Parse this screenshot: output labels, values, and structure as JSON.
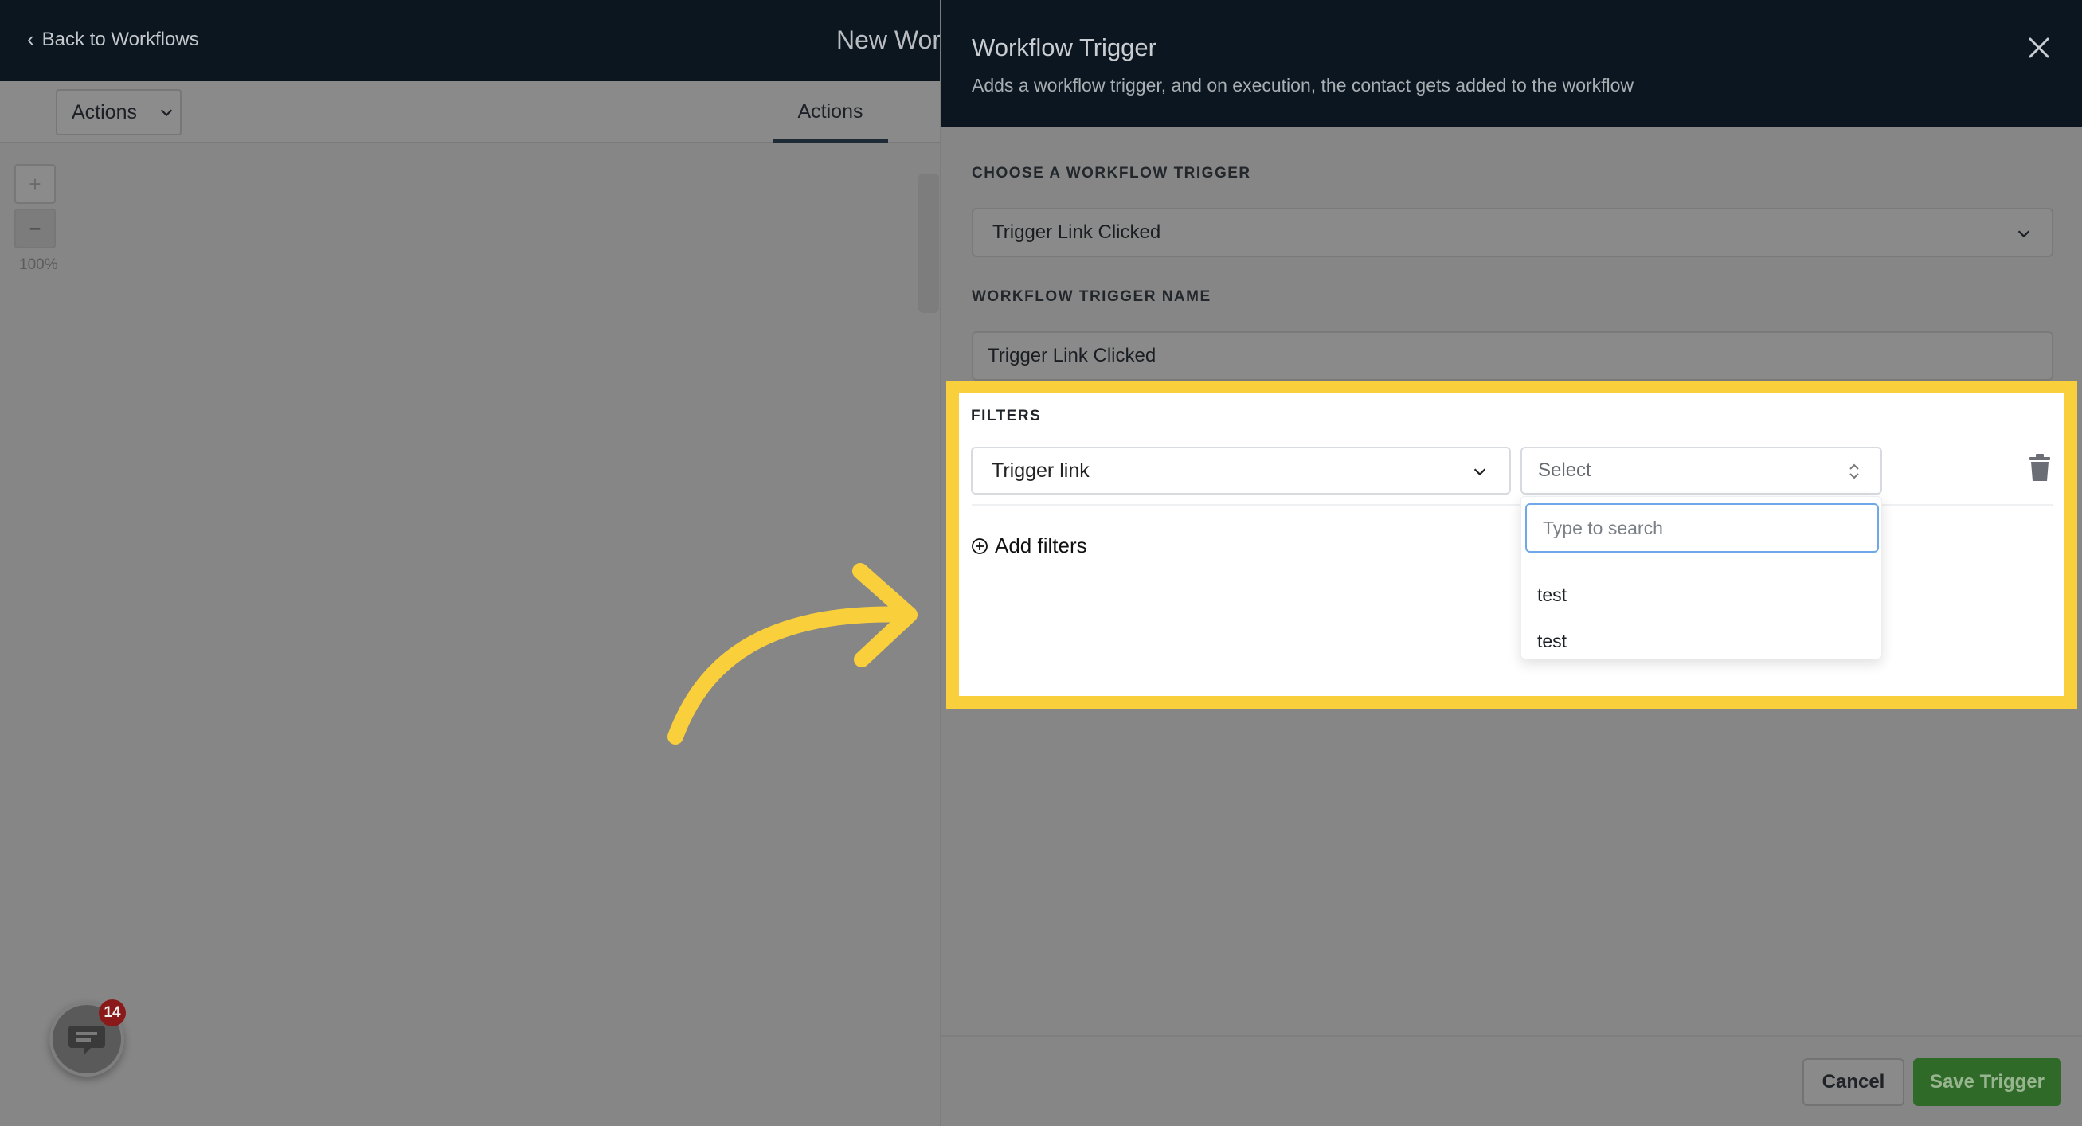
{
  "editor": {
    "back_label": "Back to Workflows",
    "workflow_title": "New Wor",
    "actions_dropdown": "Actions",
    "actions_tab": "Actions",
    "zoom_in": "+",
    "zoom_out": "−",
    "zoom_level": "100%",
    "chat_badge_count": "14"
  },
  "panel": {
    "title": "Workflow Trigger",
    "subtitle": "Adds a workflow trigger, and on execution, the contact gets added to the workflow",
    "choose_label": "CHOOSE A WORKFLOW TRIGGER",
    "choose_value": "Trigger Link Clicked",
    "name_label": "WORKFLOW TRIGGER NAME",
    "name_value": "Trigger Link Clicked"
  },
  "filters": {
    "label": "FILTERS",
    "field_value": "Trigger link",
    "value_placeholder": "Select",
    "search_placeholder": "Type to search",
    "options": [
      "test",
      "test"
    ],
    "add_label": "Add filters"
  },
  "footer": {
    "cancel_label": "Cancel",
    "save_label": "Save Trigger"
  },
  "colors": {
    "highlight": "#f9cf3c",
    "save_button": "#2f6a28",
    "header_dark": "#0b1620"
  }
}
